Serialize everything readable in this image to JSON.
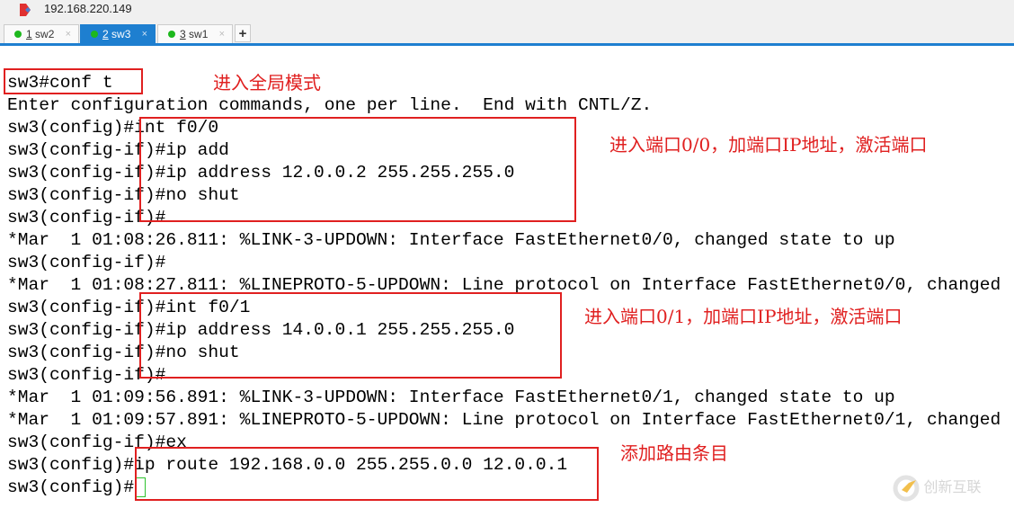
{
  "window": {
    "title": "192.168.220.149"
  },
  "tabs": [
    {
      "num": "1",
      "label": "sw2",
      "active": false
    },
    {
      "num": "2",
      "label": "sw3",
      "active": true
    },
    {
      "num": "3",
      "label": "sw1",
      "active": false
    }
  ],
  "terminal": {
    "lines": [
      "sw3#conf t",
      "Enter configuration commands, one per line.  End with CNTL/Z.",
      "sw3(config)#int f0/0",
      "sw3(config-if)#ip add",
      "sw3(config-if)#ip address 12.0.0.2 255.255.255.0",
      "sw3(config-if)#no shut",
      "sw3(config-if)#",
      "*Mar  1 01:08:26.811: %LINK-3-UPDOWN: Interface FastEthernet0/0, changed state to up",
      "sw3(config-if)#",
      "*Mar  1 01:08:27.811: %LINEPROTO-5-UPDOWN: Line protocol on Interface FastEthernet0/0, changed",
      "sw3(config-if)#int f0/1",
      "sw3(config-if)#ip address 14.0.0.1 255.255.255.0",
      "sw3(config-if)#no shut",
      "sw3(config-if)#",
      "*Mar  1 01:09:56.891: %LINK-3-UPDOWN: Interface FastEthernet0/1, changed state to up",
      "*Mar  1 01:09:57.891: %LINEPROTO-5-UPDOWN: Line protocol on Interface FastEthernet0/1, changed",
      "sw3(config-if)#ex",
      "sw3(config)#ip route 192.168.0.0 255.255.0.0 12.0.0.1",
      "sw3(config)#"
    ]
  },
  "annotations": [
    "进入全局模式",
    "进入端口0/0，加端口IP地址，激活端口",
    "进入端口0/1，加端口IP地址，激活端口",
    "添加路由条目"
  ],
  "watermark": "创新互联",
  "colors": {
    "annotation": "#e02020",
    "tab_active": "#1e7fd0",
    "status_dot": "#1db81d",
    "cursor": "#2ec22e"
  }
}
